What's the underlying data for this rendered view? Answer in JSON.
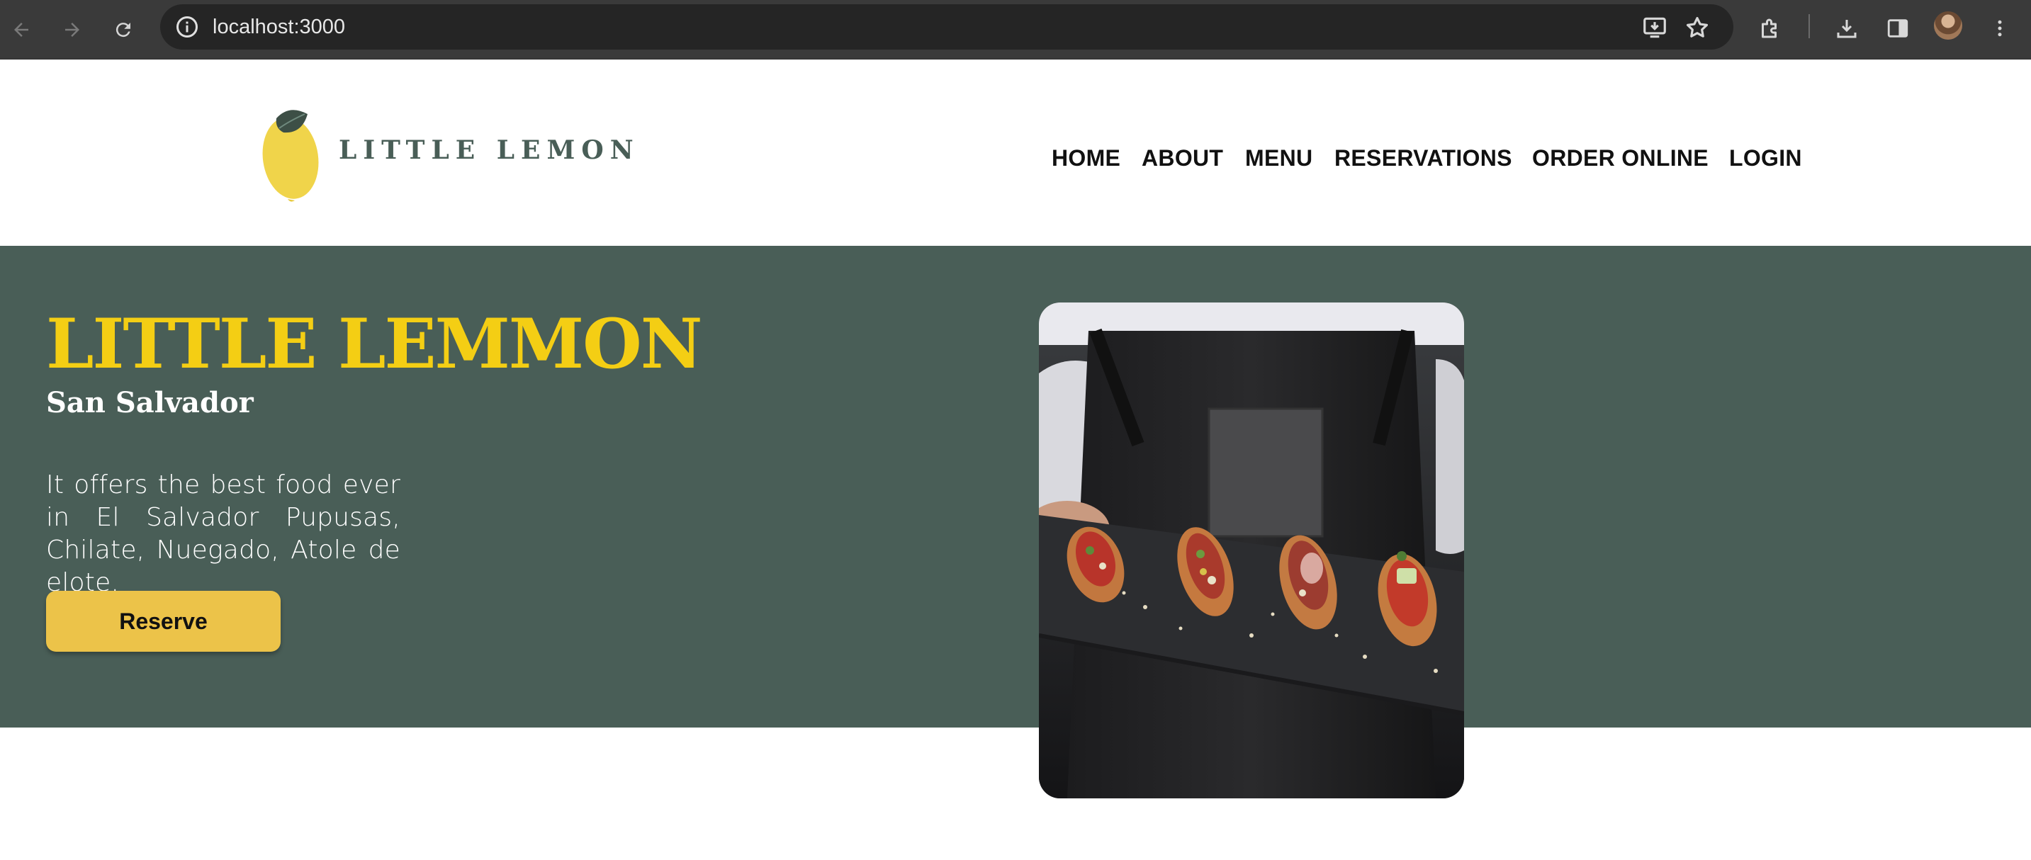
{
  "browser": {
    "url": "localhost:3000",
    "icons": [
      "back-icon",
      "forward-icon",
      "reload-icon",
      "site-info-icon",
      "install-app-icon",
      "bookmark-star-icon",
      "extensions-icon",
      "download-icon",
      "side-panel-icon",
      "profile-avatar",
      "more-menu-icon"
    ]
  },
  "header": {
    "logo_text": "LITTLE LEMON",
    "nav": [
      "HOME",
      "ABOUT",
      "MENU",
      "RESERVATIONS",
      "ORDER ONLINE",
      "LOGIN"
    ]
  },
  "hero": {
    "title": "LITTLE LEMMON",
    "subtitle": "San Salvador",
    "description": "It offers the best food ever in El Salvador Pupusas, Chilate, Nuegado, Atole de elote.",
    "button_label": "Reserve"
  },
  "colors": {
    "brand_green": "#495e57",
    "brand_yellow": "#f4ce14",
    "button_yellow": "#ecc349"
  }
}
